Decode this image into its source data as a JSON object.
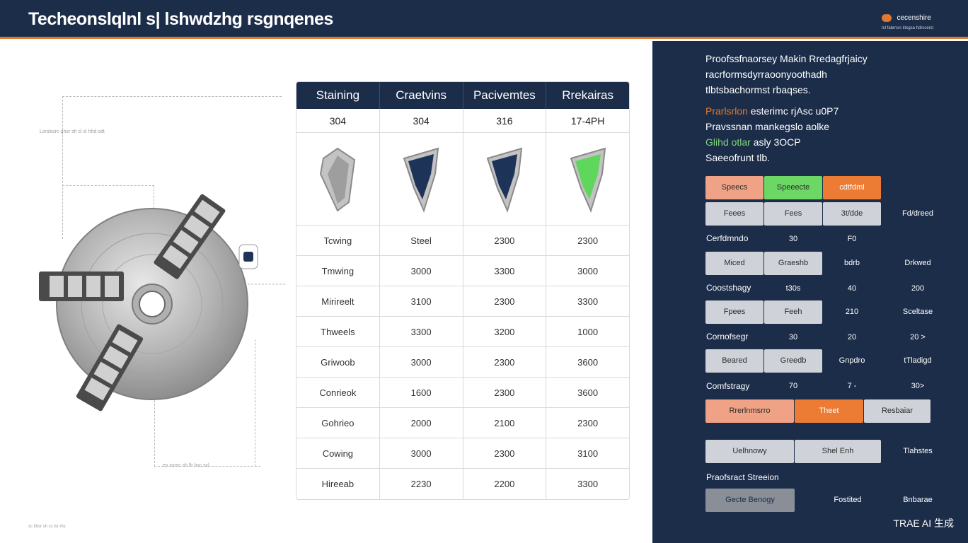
{
  "header": {
    "title": "Techeonslqlnl s| lshwdzhg rsgnqenes",
    "logo_name": "cecenshire",
    "logo_sub": "tcl fabrrcrs ktsgsa hdrscersl"
  },
  "diagram": {
    "caption_top": "Lsrslscrc ghsr sh cl sl hhd odt",
    "caption_bottom": "es ssrsc sh lh hsc scl",
    "footnote": "sc lthsr sh cc lsr rhs"
  },
  "table": {
    "headers": [
      "Staining",
      "Craetvins",
      "Pacivemtes",
      "Rrekairas"
    ],
    "grades": [
      "304",
      "304",
      "316",
      "17-4PH"
    ],
    "insert_colors": [
      "#9e9e9e",
      "#1d3458",
      "#1d3458",
      "#5fd65c"
    ],
    "rows": [
      [
        "Tcwing",
        "Steel",
        "2300",
        "2300"
      ],
      [
        "Tmwing",
        "3000",
        "3300",
        "3000"
      ],
      [
        "Mirireelt",
        "3100",
        "2300",
        "3300"
      ],
      [
        "Thweels",
        "3300",
        "3200",
        "1000"
      ],
      [
        "Griwoob",
        "3000",
        "2300",
        "3600"
      ],
      [
        "Conrieok",
        "1600",
        "2300",
        "3600"
      ],
      [
        "Gohrieo",
        "2000",
        "2100",
        "2300"
      ],
      [
        "Cowing",
        "3000",
        "2300",
        "3100"
      ],
      [
        "Hireeab",
        "2230",
        "2200",
        "3300"
      ]
    ]
  },
  "sidebar": {
    "intro_lines": [
      "Proofssfnaorsey  Makin Rredagfrjaicy",
      "racrformsdyrraoonyoothadh",
      "tlbtsbachormst rbaqses."
    ],
    "lines2": [
      {
        "accent": "Prarlsrlon",
        "text": " esterimc rjAsc u0P7"
      },
      {
        "accent": "",
        "text": "Pravssnan mankegslo aolke"
      },
      {
        "accent": "Glihd otlar",
        "text": " asly 3OCP"
      },
      {
        "accent": "",
        "text": "Saeeofrunt tlb."
      }
    ],
    "r1": [
      "Speecs",
      "Speeecte",
      "cdtfdml"
    ],
    "r2": [
      "Feees",
      "Fees",
      "3t/dde",
      "Fd/dreed"
    ],
    "r3": [
      "Cerfdmndo",
      "30",
      "F0"
    ],
    "r4": [
      "Miced",
      "Graeshb",
      "bdrb",
      "Drkwed"
    ],
    "r5": [
      "Coostshagy",
      "t30s",
      "40",
      "200"
    ],
    "r6": [
      "Fpees",
      "Feeh",
      "210",
      "Sceltase"
    ],
    "r7": [
      "Cornofsegr",
      "30",
      "20",
      "20 >"
    ],
    "r8": [
      "Beared",
      "Greedb",
      "Gnpdro",
      "tTladigd"
    ],
    "r9": [
      "Comfstragy",
      "70",
      "7 -",
      "30>"
    ],
    "r10": [
      "Rrerlnmsrro",
      "Theet",
      "Resbaiar"
    ],
    "r11": [
      "Uelhnowy",
      "Shel Enh",
      "Tlahstes"
    ],
    "section_label": "Praofsract Streeion",
    "r12": [
      "Gecte Benogy",
      "Fostited",
      "Bnbarae"
    ]
  },
  "watermark": "TRAE AI 生成"
}
